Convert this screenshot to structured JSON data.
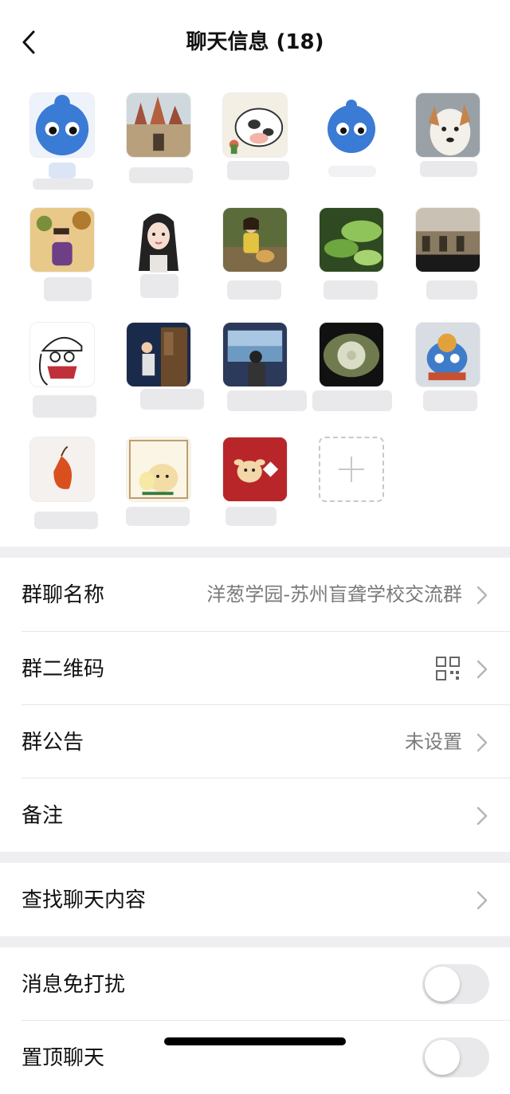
{
  "header": {
    "title": "聊天信息 (18)"
  },
  "members": [
    {
      "kind": "blob-big"
    },
    {
      "kind": "temple"
    },
    {
      "kind": "cow"
    },
    {
      "kind": "blob-small"
    },
    {
      "kind": "dog"
    },
    {
      "kind": "cartoon-girl"
    },
    {
      "kind": "anime-girl"
    },
    {
      "kind": "woman-dog"
    },
    {
      "kind": "leaves"
    },
    {
      "kind": "building"
    },
    {
      "kind": "sketch"
    },
    {
      "kind": "wall-girl"
    },
    {
      "kind": "window"
    },
    {
      "kind": "dandelion"
    },
    {
      "kind": "toy"
    },
    {
      "kind": "lantern"
    },
    {
      "kind": "card"
    },
    {
      "kind": "ox-red"
    }
  ],
  "settings_group1": [
    {
      "label": "群聊名称",
      "value": "洋葱学园-苏州盲聋学校交流群"
    },
    {
      "label": "群二维码",
      "value": ""
    },
    {
      "label": "群公告",
      "value": "未设置"
    },
    {
      "label": "备注",
      "value": ""
    }
  ],
  "settings_group2": [
    {
      "label": "查找聊天内容",
      "value": ""
    }
  ],
  "settings_group3": [
    {
      "label": "消息免打扰",
      "toggle": false
    },
    {
      "label": "置顶聊天",
      "toggle": false
    }
  ],
  "icons": {
    "back": "chevron-left-icon",
    "chevron": "chevron-right-icon",
    "qr": "qr-code-icon",
    "add": "plus-icon"
  },
  "colors": {
    "background": "#efeff2",
    "cell": "#ffffff",
    "toggle_off": "#e9e9ec"
  }
}
